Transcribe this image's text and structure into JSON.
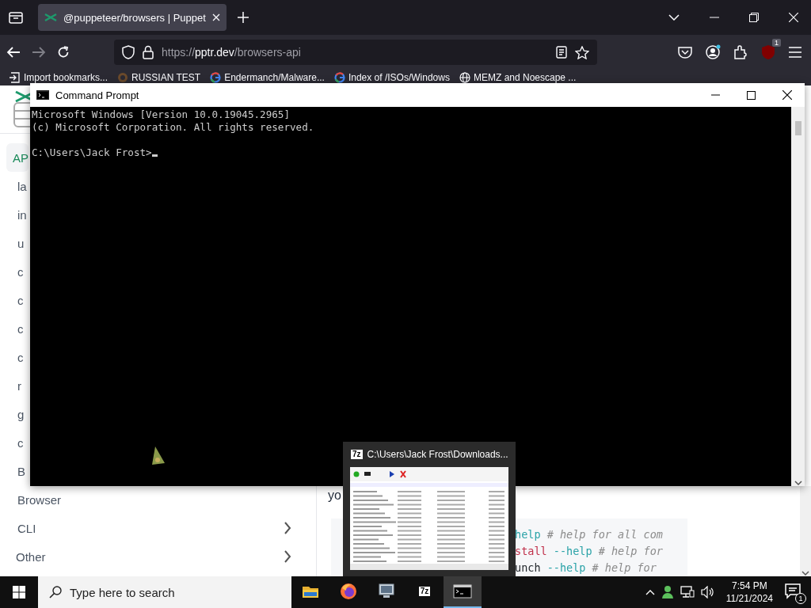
{
  "browser": {
    "tabs": [
      {
        "title": "@puppeteer/browsers | Puppet",
        "selected": true
      }
    ],
    "url": {
      "scheme": "https://",
      "host": "pptr.dev",
      "path": "/browsers-api"
    },
    "extension_badge": "1",
    "bookmarks": [
      {
        "label": "Import bookmarks...",
        "kind": "import"
      },
      {
        "label": "RUSSIAN TEST",
        "kind": "site"
      },
      {
        "label": "Endermanch/Malware...",
        "kind": "google"
      },
      {
        "label": "Index of /ISOs/Windows",
        "kind": "google"
      },
      {
        "label": "MEMZ and Noescape ...",
        "kind": "globe"
      }
    ]
  },
  "page": {
    "sidebar": {
      "items": [
        {
          "label": "AP",
          "kind": "link",
          "selected": true,
          "children": [
            {
              "label": "la",
              "kind": "link",
              "selected": false
            },
            {
              "label": "in",
              "kind": "link",
              "selected": false
            },
            {
              "label": "u",
              "kind": "link",
              "selected": false
            },
            {
              "label": "c",
              "kind": "link",
              "selected": false
            },
            {
              "label": "c",
              "kind": "link",
              "selected": false
            },
            {
              "label": "c",
              "kind": "link",
              "selected": false
            },
            {
              "label": "c",
              "kind": "link",
              "selected": false
            },
            {
              "label": "r",
              "kind": "link",
              "selected": false
            },
            {
              "label": "g",
              "kind": "link",
              "selected": false
            },
            {
              "label": "c",
              "kind": "link",
              "selected": false
            },
            {
              "label": "B",
              "kind": "link",
              "selected": false
            },
            {
              "label": "Browser",
              "kind": "link",
              "selected": false
            },
            {
              "label": "CLI",
              "kind": "category",
              "selected": false,
              "expanded": false
            }
          ]
        },
        {
          "label": "Other",
          "kind": "category",
          "selected": false,
          "expanded": false
        }
      ]
    },
    "content": {
      "text_fragment": "yo",
      "code_lines": [
        {
          "parts": [
            {
              "text": "help",
              "kind": "flag"
            },
            {
              "text": " # help for all com",
              "kind": "comment"
            }
          ]
        },
        {
          "parts": [
            {
              "text": "stall",
              "kind": "command"
            },
            {
              "text": " --help",
              "kind": "flag"
            },
            {
              "text": " # help for",
              "kind": "comment"
            }
          ]
        },
        {
          "parts": [
            {
              "text": "unch",
              "kind": "plain"
            },
            {
              "text": " --help",
              "kind": "flag"
            },
            {
              "text": " # help for",
              "kind": "comment"
            }
          ]
        }
      ]
    }
  },
  "console_window": {
    "title": "Command Prompt",
    "output": [
      "Microsoft Windows [Version 10.0.19045.2965]",
      "(c) Microsoft Corporation. All rights reserved."
    ],
    "prompt": "C:\\Users\\Jack Frost>"
  },
  "taskbar_preview": {
    "title": "C:\\Users\\Jack Frost\\Downloads...",
    "icon_label": "7z"
  },
  "taskbar": {
    "search": {
      "placeholder": "Type here to search"
    },
    "apps": [
      {
        "kind": "folder",
        "selected": false
      },
      {
        "kind": "firefox",
        "selected": false
      },
      {
        "kind": "monitor",
        "selected": false
      },
      {
        "kind": "sevenzip",
        "label": "7z",
        "selected": false
      },
      {
        "kind": "console",
        "selected": true
      }
    ],
    "time": "7:54 PM",
    "date": "11/21/2024",
    "notification_count": "1"
  }
}
